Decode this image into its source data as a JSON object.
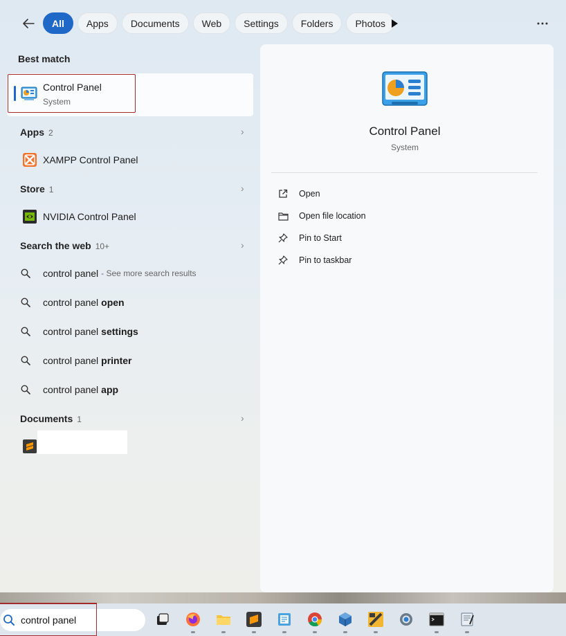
{
  "filters": {
    "tabs": [
      "All",
      "Apps",
      "Documents",
      "Web",
      "Settings",
      "Folders",
      "Photos"
    ],
    "active": "All"
  },
  "best_match": {
    "heading": "Best match",
    "title": "Control Panel",
    "subtitle": "System"
  },
  "apps": {
    "heading": "Apps",
    "count": "2",
    "items": [
      "XAMPP Control Panel"
    ]
  },
  "store": {
    "heading": "Store",
    "count": "1",
    "items": [
      "NVIDIA Control Panel"
    ]
  },
  "web": {
    "heading": "Search the web",
    "count": "10+",
    "first_query": "control panel",
    "first_extra": "- See more search results",
    "prefix": "control panel",
    "suggestions": [
      "open",
      "settings",
      "printer",
      "app"
    ]
  },
  "documents": {
    "heading": "Documents",
    "count": "1"
  },
  "detail": {
    "title": "Control Panel",
    "subtitle": "System",
    "actions": [
      "Open",
      "Open file location",
      "Pin to Start",
      "Pin to taskbar"
    ]
  },
  "taskbar": {
    "search_value": "control panel",
    "apps": [
      "task-view-icon",
      "firefox-icon",
      "file-explorer-icon",
      "sublime-text-icon",
      "notepad-icon",
      "chrome-icon",
      "virtualbox-icon",
      "cs-app-icon",
      "settings-icon",
      "terminal-icon",
      "editor-icon"
    ]
  },
  "colors": {
    "accent": "#1f68c8",
    "highlight_outline": "#a32a2a"
  }
}
